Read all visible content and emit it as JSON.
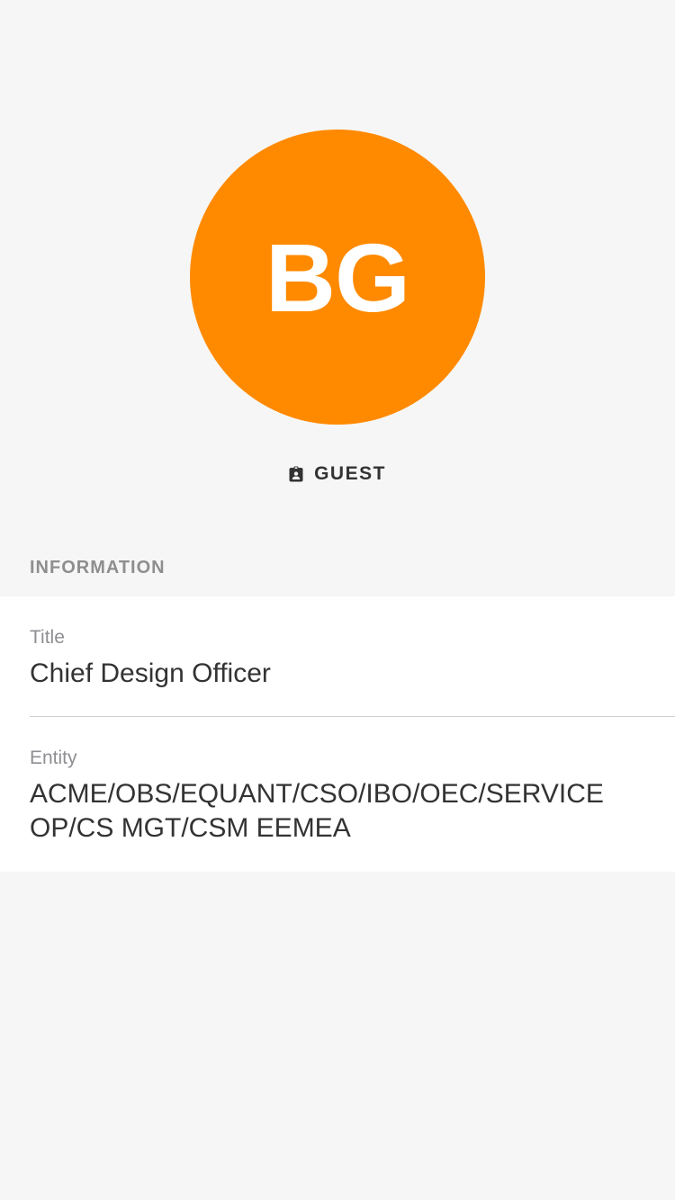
{
  "profile": {
    "initials": "BG",
    "avatar_color": "#ff8a00",
    "role_icon": "badge-icon",
    "role_label": "GUEST"
  },
  "information": {
    "header": "INFORMATION",
    "fields": [
      {
        "label": "Title",
        "value": "Chief Design Officer"
      },
      {
        "label": "Entity",
        "value": "ACME/OBS/EQUANT/CSO/IBO/OEC/SERVICE OP/CS MGT/CSM EEMEA"
      }
    ]
  }
}
